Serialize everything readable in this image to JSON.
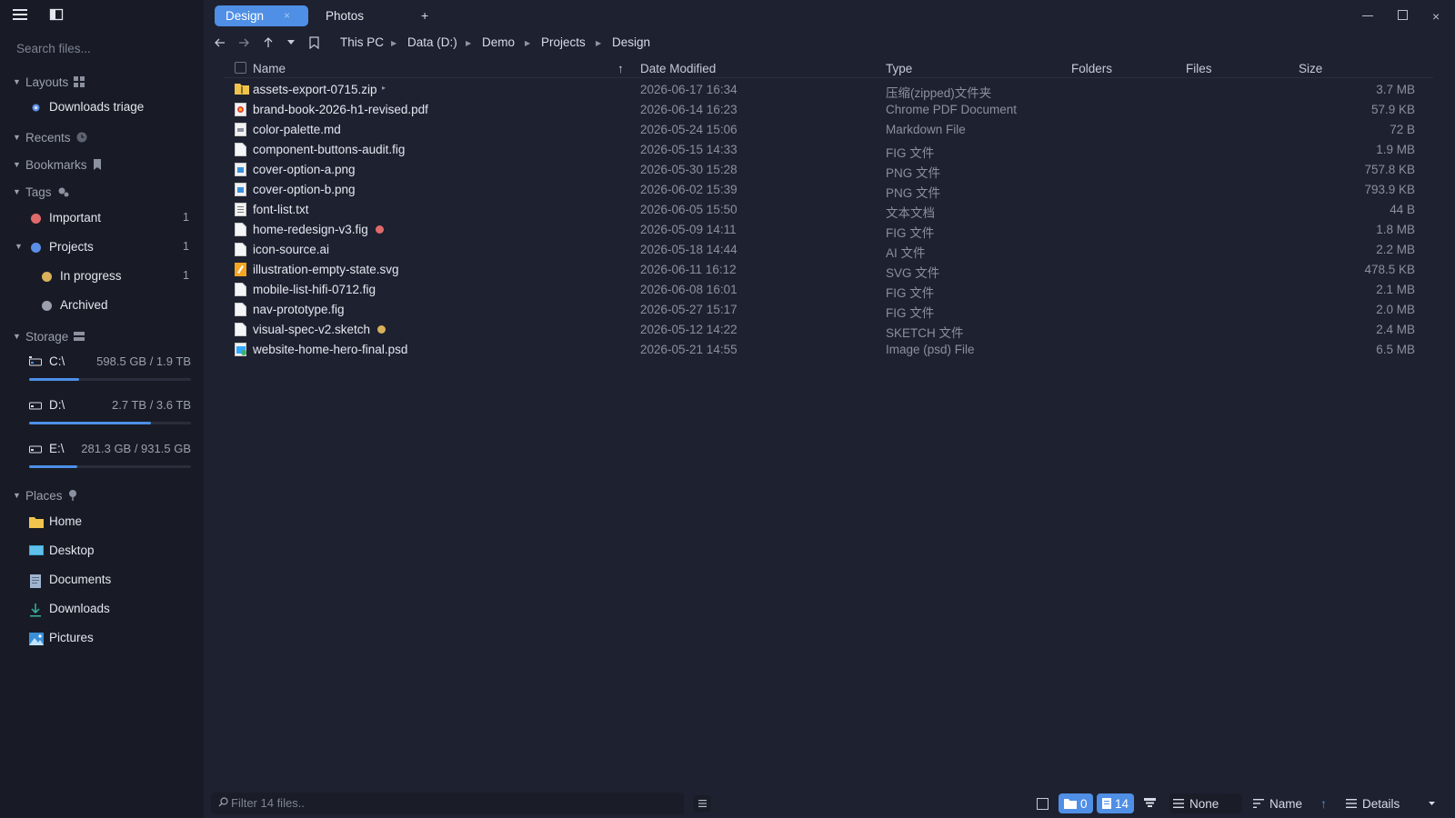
{
  "colors": {
    "accent": "#4f8fe5",
    "tag_important": "#e06a6a",
    "tag_projects": "#5b8ee6",
    "tag_in_progress": "#d9b15a",
    "tag_archived": "#9aa0ae"
  },
  "sidebar": {
    "search_placeholder": "Search files...",
    "sections": {
      "layouts": "Layouts",
      "recents": "Recents",
      "bookmarks": "Bookmarks",
      "tags": "Tags",
      "storage": "Storage",
      "places": "Places"
    },
    "layouts": [
      {
        "label": "Downloads triage"
      }
    ],
    "tags": [
      {
        "label": "Important",
        "count": "1"
      },
      {
        "label": "Projects",
        "count": "1"
      },
      {
        "label": "In progress",
        "count": "1"
      },
      {
        "label": "Archived",
        "count": ""
      }
    ],
    "drives": [
      {
        "name": "C:\\",
        "size": "598.5 GB / 1.9 TB",
        "used_fraction": 0.31
      },
      {
        "name": "D:\\",
        "size": "2.7 TB / 3.6 TB",
        "used_fraction": 0.75
      },
      {
        "name": "E:\\",
        "size": "281.3 GB / 931.5 GB",
        "used_fraction": 0.3
      }
    ],
    "places": [
      {
        "label": "Home",
        "icon": "folder-icon"
      },
      {
        "label": "Desktop",
        "icon": "desktop-icon"
      },
      {
        "label": "Documents",
        "icon": "documents-icon"
      },
      {
        "label": "Downloads",
        "icon": "download-icon"
      },
      {
        "label": "Pictures",
        "icon": "pictures-icon"
      }
    ]
  },
  "tabs": [
    {
      "label": "Design",
      "close": "×"
    },
    {
      "label": "Photos"
    }
  ],
  "tab_add": "+",
  "window": {
    "minimize": "—",
    "close": "×"
  },
  "breadcrumb": [
    "This PC",
    "Data (D:)",
    "Demo",
    "Projects",
    "Design"
  ],
  "columns": {
    "name": "Name",
    "date": "Date Modified",
    "type": "Type",
    "folders": "Folders",
    "files": "Files",
    "size": "Size",
    "sort_indicator": "↑"
  },
  "files": [
    {
      "name": "assets-export-0715.zip",
      "date": "2026-06-17 16:34",
      "type": "压缩(zipped)文件夹",
      "size": "3.7 MB",
      "icon": "zip-folder-icon",
      "tag": "",
      "expand": "▸"
    },
    {
      "name": "brand-book-2026-h1-revised.pdf",
      "date": "2026-06-14 16:23",
      "type": "Chrome PDF Document",
      "size": "57.9 KB",
      "icon": "pdf-icon",
      "tag": ""
    },
    {
      "name": "color-palette.md",
      "date": "2026-05-24 15:06",
      "type": "Markdown File",
      "size": "72 B",
      "icon": "markdown-icon",
      "tag": ""
    },
    {
      "name": "component-buttons-audit.fig",
      "date": "2026-05-15 14:33",
      "type": "FIG 文件",
      "size": "1.9 MB",
      "icon": "file-icon",
      "tag": ""
    },
    {
      "name": "cover-option-a.png",
      "date": "2026-05-30 15:28",
      "type": "PNG 文件",
      "size": "757.8 KB",
      "icon": "image-file-icon",
      "tag": ""
    },
    {
      "name": "cover-option-b.png",
      "date": "2026-06-02 15:39",
      "type": "PNG 文件",
      "size": "793.9 KB",
      "icon": "image-file-icon",
      "tag": ""
    },
    {
      "name": "font-list.txt",
      "date": "2026-06-05 15:50",
      "type": "文本文档",
      "size": "44 B",
      "icon": "text-file-icon",
      "tag": ""
    },
    {
      "name": "home-redesign-v3.fig",
      "date": "2026-05-09 14:11",
      "type": "FIG 文件",
      "size": "1.8 MB",
      "icon": "file-icon",
      "tag": "#e06a6a"
    },
    {
      "name": "icon-source.ai",
      "date": "2026-05-18 14:44",
      "type": "AI 文件",
      "size": "2.2 MB",
      "icon": "file-icon",
      "tag": ""
    },
    {
      "name": "illustration-empty-state.svg",
      "date": "2026-06-11 16:12",
      "type": "SVG 文件",
      "size": "478.5 KB",
      "icon": "svg-file-icon",
      "tag": ""
    },
    {
      "name": "mobile-list-hifi-0712.fig",
      "date": "2026-06-08 16:01",
      "type": "FIG 文件",
      "size": "2.1 MB",
      "icon": "file-icon",
      "tag": ""
    },
    {
      "name": "nav-prototype.fig",
      "date": "2026-05-27 15:17",
      "type": "FIG 文件",
      "size": "2.0 MB",
      "icon": "file-icon",
      "tag": ""
    },
    {
      "name": "visual-spec-v2.sketch",
      "date": "2026-05-12 14:22",
      "type": "SKETCH 文件",
      "size": "2.4 MB",
      "icon": "file-icon",
      "tag": "#d9b15a"
    },
    {
      "name": "website-home-hero-final.psd",
      "date": "2026-05-21 14:55",
      "type": "Image (psd) File",
      "size": "6.5 MB",
      "icon": "psd-file-icon",
      "tag": ""
    }
  ],
  "statusbar": {
    "filter_placeholder": "Filter 14 files..",
    "folder_count": "0",
    "file_count": "14",
    "group_by": "None",
    "sort_by": "Name",
    "sort_dir": "↑",
    "view": "Details"
  }
}
